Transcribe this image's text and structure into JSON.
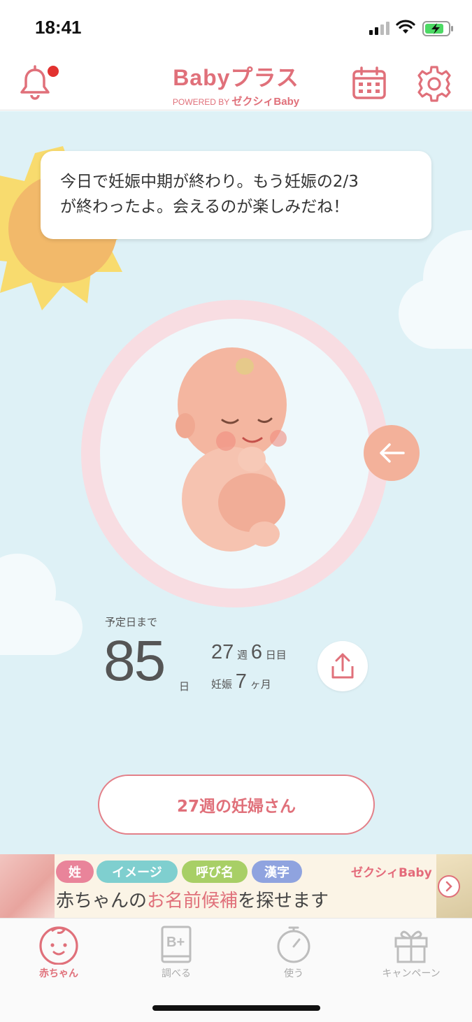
{
  "status": {
    "time": "18:41"
  },
  "header": {
    "logo_main": "Babyプラス",
    "logo_powered": "POWERED BY",
    "logo_brand": "ゼクシィBaby"
  },
  "speech": {
    "line1": "今日で妊娠中期が終わり。もう妊娠の2/3",
    "line2": "が終わったよ。会えるのが楽しみだね！"
  },
  "countdown": {
    "label": "予定日まで",
    "days": "85",
    "days_unit": "日",
    "weeks": "27",
    "weeks_unit": "週",
    "day_of_week": "6",
    "day_unit": "日目",
    "pregnancy_prefix": "妊娠",
    "months": "7",
    "months_unit": "ヶ月"
  },
  "week_button": {
    "label": "27週の妊婦さん"
  },
  "banner": {
    "tags": [
      "姓",
      "イメージ",
      "呼び名",
      "漢字"
    ],
    "brand": "ゼクシィBaby",
    "title_pre": "赤ちゃんの",
    "title_highlight": "お名前候補",
    "title_post": "を探せます"
  },
  "tabs": [
    {
      "label": "赤ちゃん",
      "icon": "baby-face-icon",
      "active": true
    },
    {
      "label": "調べる",
      "icon": "book-icon",
      "active": false
    },
    {
      "label": "使う",
      "icon": "stopwatch-icon",
      "active": false
    },
    {
      "label": "キャンペーン",
      "icon": "gift-icon",
      "active": false
    }
  ],
  "colors": {
    "accent": "#e0707a",
    "sky": "#def1f6",
    "womb": "#f8dde2",
    "notification": "#e2312f"
  }
}
